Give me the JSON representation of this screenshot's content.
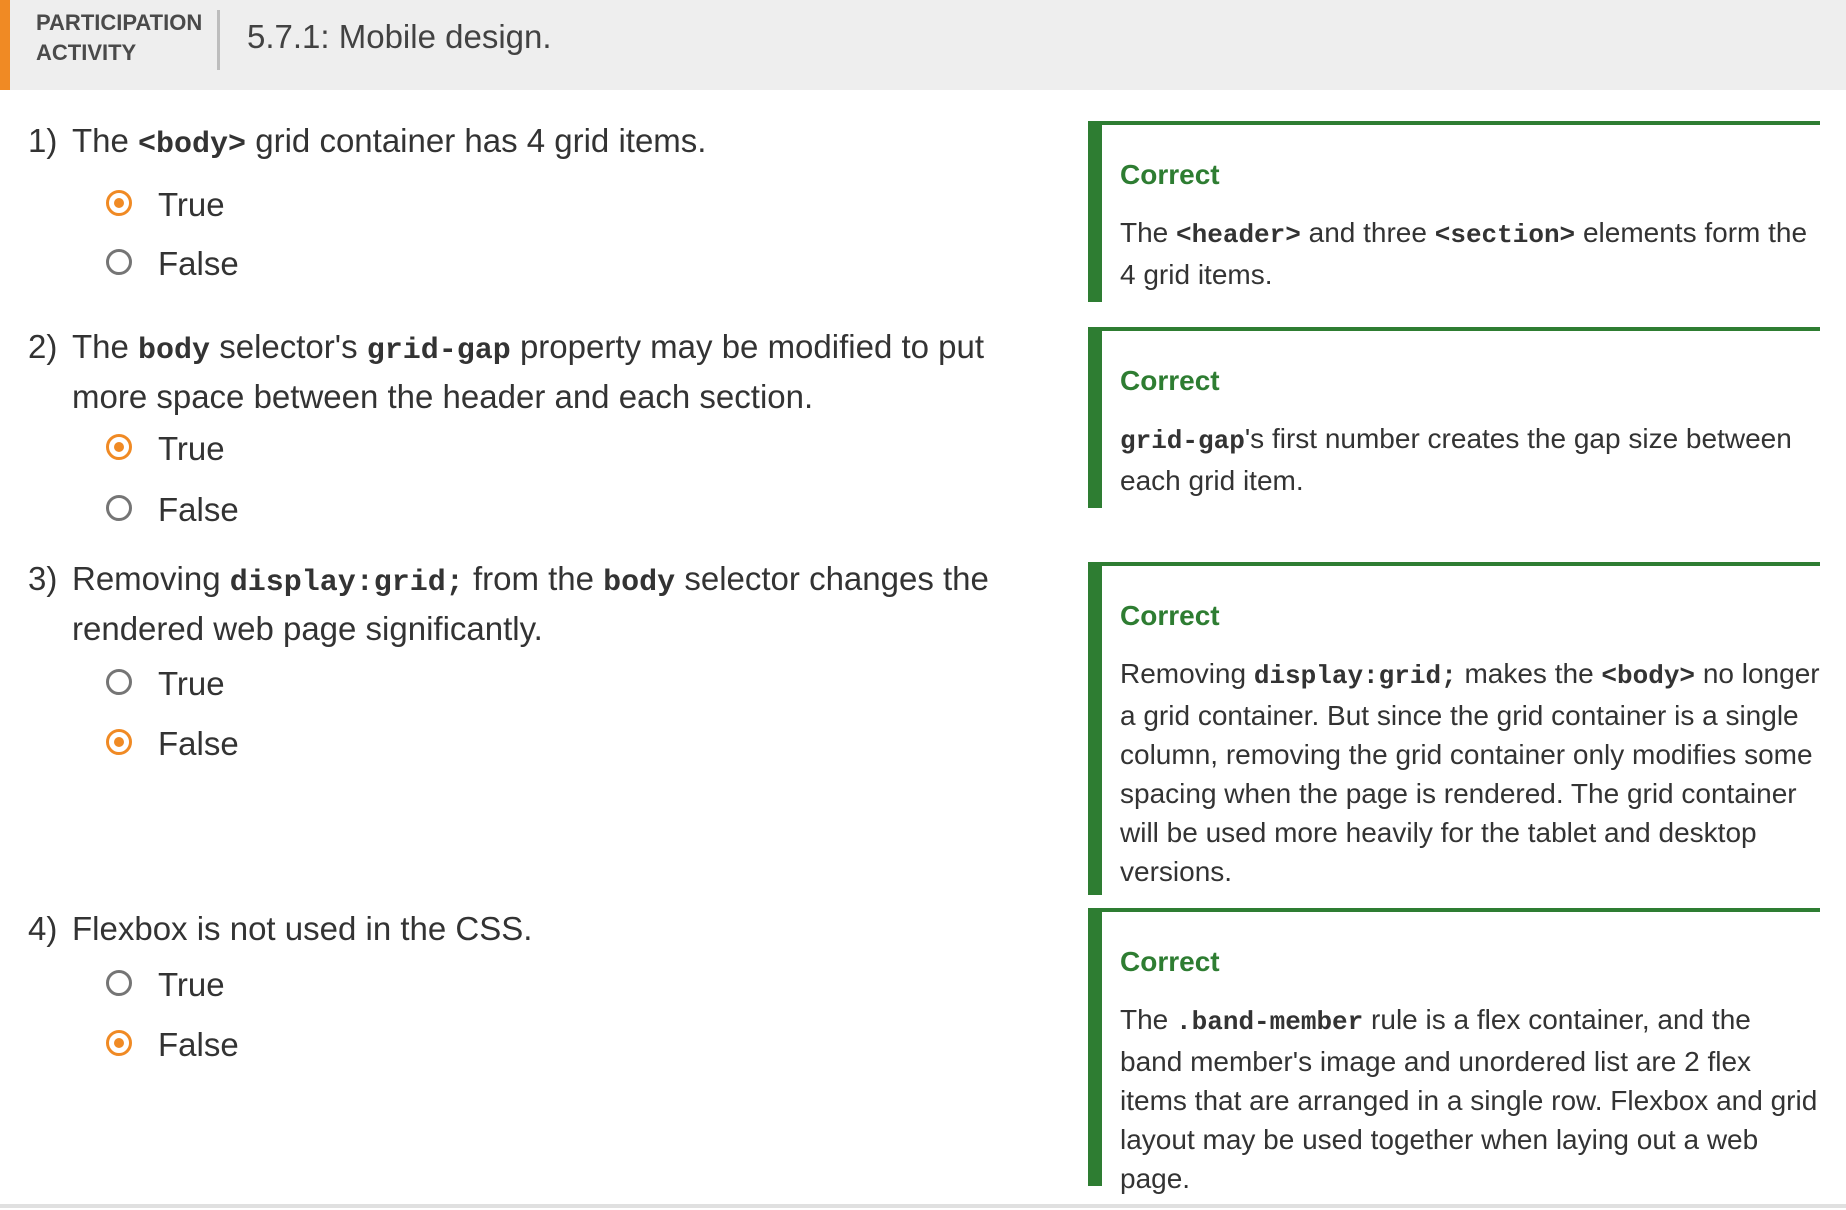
{
  "activity": {
    "label_line1": "PARTICIPATION",
    "label_line2": "ACTIVITY",
    "title": "5.7.1: Mobile design."
  },
  "questions": [
    {
      "number": "1)",
      "text": [
        [
          "The ",
          false
        ],
        [
          "<body>",
          true
        ],
        [
          " grid container has 4 grid items.",
          false
        ]
      ],
      "options": [
        "True",
        "False"
      ],
      "selected": "True",
      "feedback": {
        "status": "Correct",
        "text": [
          [
            "The ",
            false
          ],
          [
            "<header>",
            true
          ],
          [
            " and three ",
            false
          ],
          [
            "<section>",
            true
          ],
          [
            " elements form the 4 grid items.",
            false
          ]
        ]
      }
    },
    {
      "number": "2)",
      "text": [
        [
          "The ",
          false
        ],
        [
          "body",
          true
        ],
        [
          " selector's ",
          false
        ],
        [
          "grid-gap",
          true
        ],
        [
          " property may be modified to put more space between the header and each section.",
          false
        ]
      ],
      "options": [
        "True",
        "False"
      ],
      "selected": "True",
      "feedback": {
        "status": "Correct",
        "text": [
          [
            "grid-gap",
            true
          ],
          [
            "'s first number creates the gap size between each grid item.",
            false
          ]
        ]
      }
    },
    {
      "number": "3)",
      "text": [
        [
          "Removing ",
          false
        ],
        [
          "display:grid;",
          true
        ],
        [
          " from the ",
          false
        ],
        [
          "body",
          true
        ],
        [
          " selector changes the rendered web page significantly.",
          false
        ]
      ],
      "options": [
        "True",
        "False"
      ],
      "selected": "False",
      "feedback": {
        "status": "Correct",
        "text": [
          [
            "Removing ",
            false
          ],
          [
            "display:grid;",
            true
          ],
          [
            " makes the ",
            false
          ],
          [
            "<body>",
            true
          ],
          [
            " no longer a grid container. But since the grid container is a single column, removing the grid container only modifies some spacing when the page is rendered. The grid container will be used more heavily for the tablet and desktop versions.",
            false
          ]
        ]
      }
    },
    {
      "number": "4)",
      "text": [
        [
          "Flexbox is not used in the CSS.",
          false
        ]
      ],
      "options": [
        "True",
        "False"
      ],
      "selected": "False",
      "feedback": {
        "status": "Correct",
        "text": [
          [
            "The ",
            false
          ],
          [
            ".band-member",
            true
          ],
          [
            " rule is a flex container, and the band member's image and unordered list are 2 flex items that are arranged in a single row. Flexbox and grid layout may be used together when laying out a web page.",
            false
          ]
        ]
      }
    }
  ],
  "colors": {
    "accent": "#f08a24",
    "correct": "#2e7d32"
  }
}
